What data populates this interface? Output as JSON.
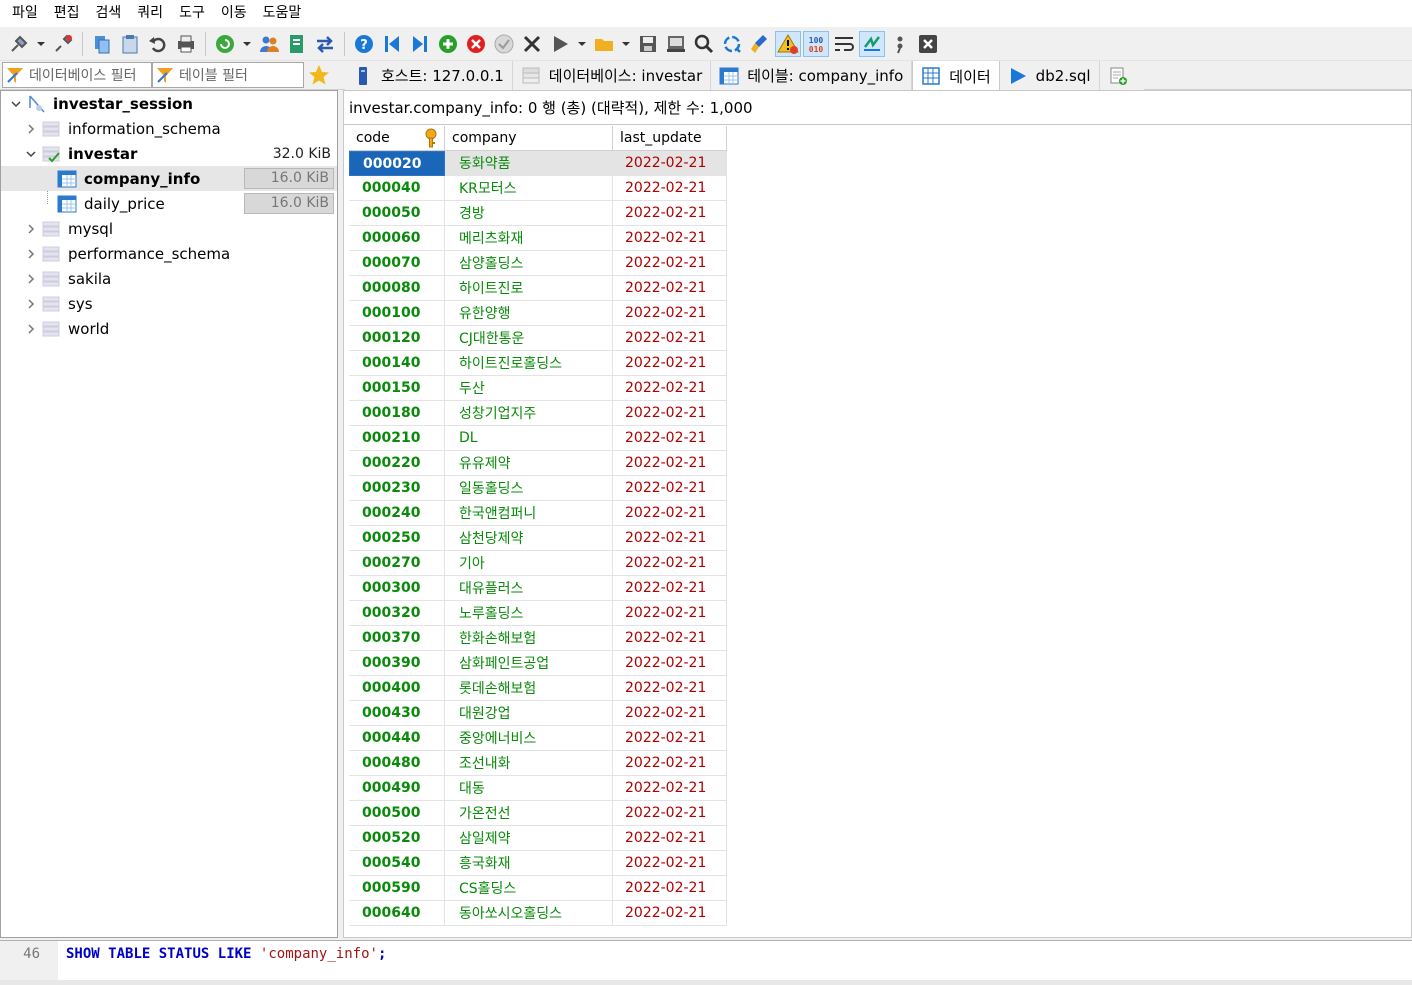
{
  "menu": [
    "파일",
    "편집",
    "검색",
    "쿼리",
    "도구",
    "이동",
    "도움말"
  ],
  "filters": {
    "database_filter_placeholder": "데이터베이스 필터",
    "table_filter_placeholder": "테이블 필터"
  },
  "tabs": [
    {
      "label": "호스트: 127.0.0.1",
      "icon": "host-icon"
    },
    {
      "label": "데이터베이스: investar",
      "icon": "database-icon"
    },
    {
      "label": "테이블: company_info",
      "icon": "table-icon"
    },
    {
      "label": "데이터",
      "icon": "grid-icon",
      "active": true
    },
    {
      "label": "db2.sql",
      "icon": "play-icon"
    }
  ],
  "tree": {
    "session": "investar_session",
    "databases": [
      {
        "name": "information_schema"
      },
      {
        "name": "investar",
        "size": "32.0 KiB",
        "expanded": true,
        "tables": [
          {
            "name": "company_info",
            "size": "16.0 KiB",
            "selected": true
          },
          {
            "name": "daily_price",
            "size": "16.0 KiB"
          }
        ]
      },
      {
        "name": "mysql"
      },
      {
        "name": "performance_schema"
      },
      {
        "name": "sakila"
      },
      {
        "name": "sys"
      },
      {
        "name": "world"
      }
    ]
  },
  "info_text": "investar.company_info: 0 행 (총) (대략적), 제한 수: 1,000",
  "grid": {
    "columns": [
      "code",
      "company",
      "last_update"
    ],
    "rows": [
      [
        "000020",
        "동화약품",
        "2022-02-21"
      ],
      [
        "000040",
        "KR모터스",
        "2022-02-21"
      ],
      [
        "000050",
        "경방",
        "2022-02-21"
      ],
      [
        "000060",
        "메리츠화재",
        "2022-02-21"
      ],
      [
        "000070",
        "삼양홀딩스",
        "2022-02-21"
      ],
      [
        "000080",
        "하이트진로",
        "2022-02-21"
      ],
      [
        "000100",
        "유한양행",
        "2022-02-21"
      ],
      [
        "000120",
        "CJ대한통운",
        "2022-02-21"
      ],
      [
        "000140",
        "하이트진로홀딩스",
        "2022-02-21"
      ],
      [
        "000150",
        "두산",
        "2022-02-21"
      ],
      [
        "000180",
        "성창기업지주",
        "2022-02-21"
      ],
      [
        "000210",
        "DL",
        "2022-02-21"
      ],
      [
        "000220",
        "유유제약",
        "2022-02-21"
      ],
      [
        "000230",
        "일동홀딩스",
        "2022-02-21"
      ],
      [
        "000240",
        "한국앤컴퍼니",
        "2022-02-21"
      ],
      [
        "000250",
        "삼천당제약",
        "2022-02-21"
      ],
      [
        "000270",
        "기아",
        "2022-02-21"
      ],
      [
        "000300",
        "대유플러스",
        "2022-02-21"
      ],
      [
        "000320",
        "노루홀딩스",
        "2022-02-21"
      ],
      [
        "000370",
        "한화손해보험",
        "2022-02-21"
      ],
      [
        "000390",
        "삼화페인트공업",
        "2022-02-21"
      ],
      [
        "000400",
        "롯데손해보험",
        "2022-02-21"
      ],
      [
        "000430",
        "대원강업",
        "2022-02-21"
      ],
      [
        "000440",
        "중앙에너비스",
        "2022-02-21"
      ],
      [
        "000480",
        "조선내화",
        "2022-02-21"
      ],
      [
        "000490",
        "대동",
        "2022-02-21"
      ],
      [
        "000500",
        "가온전선",
        "2022-02-21"
      ],
      [
        "000520",
        "삼일제약",
        "2022-02-21"
      ],
      [
        "000540",
        "흥국화재",
        "2022-02-21"
      ],
      [
        "000590",
        "CS홀딩스",
        "2022-02-21"
      ],
      [
        "000640",
        "동아쏘시오홀딩스",
        "2022-02-21"
      ]
    ],
    "selected_row": 0
  },
  "query": {
    "line_number": "46",
    "kw1": "SHOW",
    "kw2": "TABLE",
    "kw3": "STATUS",
    "kw4": "LIKE",
    "literal": "'company_info'",
    "terminator": ";"
  }
}
